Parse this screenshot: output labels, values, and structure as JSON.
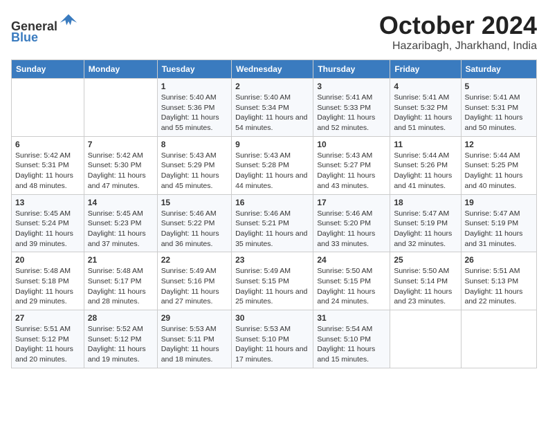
{
  "header": {
    "logo_line1": "General",
    "logo_line2": "Blue",
    "month": "October 2024",
    "location": "Hazaribagh, Jharkhand, India"
  },
  "weekdays": [
    "Sunday",
    "Monday",
    "Tuesday",
    "Wednesday",
    "Thursday",
    "Friday",
    "Saturday"
  ],
  "weeks": [
    [
      {
        "day": "",
        "info": ""
      },
      {
        "day": "",
        "info": ""
      },
      {
        "day": "1",
        "info": "Sunrise: 5:40 AM\nSunset: 5:36 PM\nDaylight: 11 hours and 55 minutes."
      },
      {
        "day": "2",
        "info": "Sunrise: 5:40 AM\nSunset: 5:34 PM\nDaylight: 11 hours and 54 minutes."
      },
      {
        "day": "3",
        "info": "Sunrise: 5:41 AM\nSunset: 5:33 PM\nDaylight: 11 hours and 52 minutes."
      },
      {
        "day": "4",
        "info": "Sunrise: 5:41 AM\nSunset: 5:32 PM\nDaylight: 11 hours and 51 minutes."
      },
      {
        "day": "5",
        "info": "Sunrise: 5:41 AM\nSunset: 5:31 PM\nDaylight: 11 hours and 50 minutes."
      }
    ],
    [
      {
        "day": "6",
        "info": "Sunrise: 5:42 AM\nSunset: 5:31 PM\nDaylight: 11 hours and 48 minutes."
      },
      {
        "day": "7",
        "info": "Sunrise: 5:42 AM\nSunset: 5:30 PM\nDaylight: 11 hours and 47 minutes."
      },
      {
        "day": "8",
        "info": "Sunrise: 5:43 AM\nSunset: 5:29 PM\nDaylight: 11 hours and 45 minutes."
      },
      {
        "day": "9",
        "info": "Sunrise: 5:43 AM\nSunset: 5:28 PM\nDaylight: 11 hours and 44 minutes."
      },
      {
        "day": "10",
        "info": "Sunrise: 5:43 AM\nSunset: 5:27 PM\nDaylight: 11 hours and 43 minutes."
      },
      {
        "day": "11",
        "info": "Sunrise: 5:44 AM\nSunset: 5:26 PM\nDaylight: 11 hours and 41 minutes."
      },
      {
        "day": "12",
        "info": "Sunrise: 5:44 AM\nSunset: 5:25 PM\nDaylight: 11 hours and 40 minutes."
      }
    ],
    [
      {
        "day": "13",
        "info": "Sunrise: 5:45 AM\nSunset: 5:24 PM\nDaylight: 11 hours and 39 minutes."
      },
      {
        "day": "14",
        "info": "Sunrise: 5:45 AM\nSunset: 5:23 PM\nDaylight: 11 hours and 37 minutes."
      },
      {
        "day": "15",
        "info": "Sunrise: 5:46 AM\nSunset: 5:22 PM\nDaylight: 11 hours and 36 minutes."
      },
      {
        "day": "16",
        "info": "Sunrise: 5:46 AM\nSunset: 5:21 PM\nDaylight: 11 hours and 35 minutes."
      },
      {
        "day": "17",
        "info": "Sunrise: 5:46 AM\nSunset: 5:20 PM\nDaylight: 11 hours and 33 minutes."
      },
      {
        "day": "18",
        "info": "Sunrise: 5:47 AM\nSunset: 5:19 PM\nDaylight: 11 hours and 32 minutes."
      },
      {
        "day": "19",
        "info": "Sunrise: 5:47 AM\nSunset: 5:19 PM\nDaylight: 11 hours and 31 minutes."
      }
    ],
    [
      {
        "day": "20",
        "info": "Sunrise: 5:48 AM\nSunset: 5:18 PM\nDaylight: 11 hours and 29 minutes."
      },
      {
        "day": "21",
        "info": "Sunrise: 5:48 AM\nSunset: 5:17 PM\nDaylight: 11 hours and 28 minutes."
      },
      {
        "day": "22",
        "info": "Sunrise: 5:49 AM\nSunset: 5:16 PM\nDaylight: 11 hours and 27 minutes."
      },
      {
        "day": "23",
        "info": "Sunrise: 5:49 AM\nSunset: 5:15 PM\nDaylight: 11 hours and 25 minutes."
      },
      {
        "day": "24",
        "info": "Sunrise: 5:50 AM\nSunset: 5:15 PM\nDaylight: 11 hours and 24 minutes."
      },
      {
        "day": "25",
        "info": "Sunrise: 5:50 AM\nSunset: 5:14 PM\nDaylight: 11 hours and 23 minutes."
      },
      {
        "day": "26",
        "info": "Sunrise: 5:51 AM\nSunset: 5:13 PM\nDaylight: 11 hours and 22 minutes."
      }
    ],
    [
      {
        "day": "27",
        "info": "Sunrise: 5:51 AM\nSunset: 5:12 PM\nDaylight: 11 hours and 20 minutes."
      },
      {
        "day": "28",
        "info": "Sunrise: 5:52 AM\nSunset: 5:12 PM\nDaylight: 11 hours and 19 minutes."
      },
      {
        "day": "29",
        "info": "Sunrise: 5:53 AM\nSunset: 5:11 PM\nDaylight: 11 hours and 18 minutes."
      },
      {
        "day": "30",
        "info": "Sunrise: 5:53 AM\nSunset: 5:10 PM\nDaylight: 11 hours and 17 minutes."
      },
      {
        "day": "31",
        "info": "Sunrise: 5:54 AM\nSunset: 5:10 PM\nDaylight: 11 hours and 15 minutes."
      },
      {
        "day": "",
        "info": ""
      },
      {
        "day": "",
        "info": ""
      }
    ]
  ]
}
